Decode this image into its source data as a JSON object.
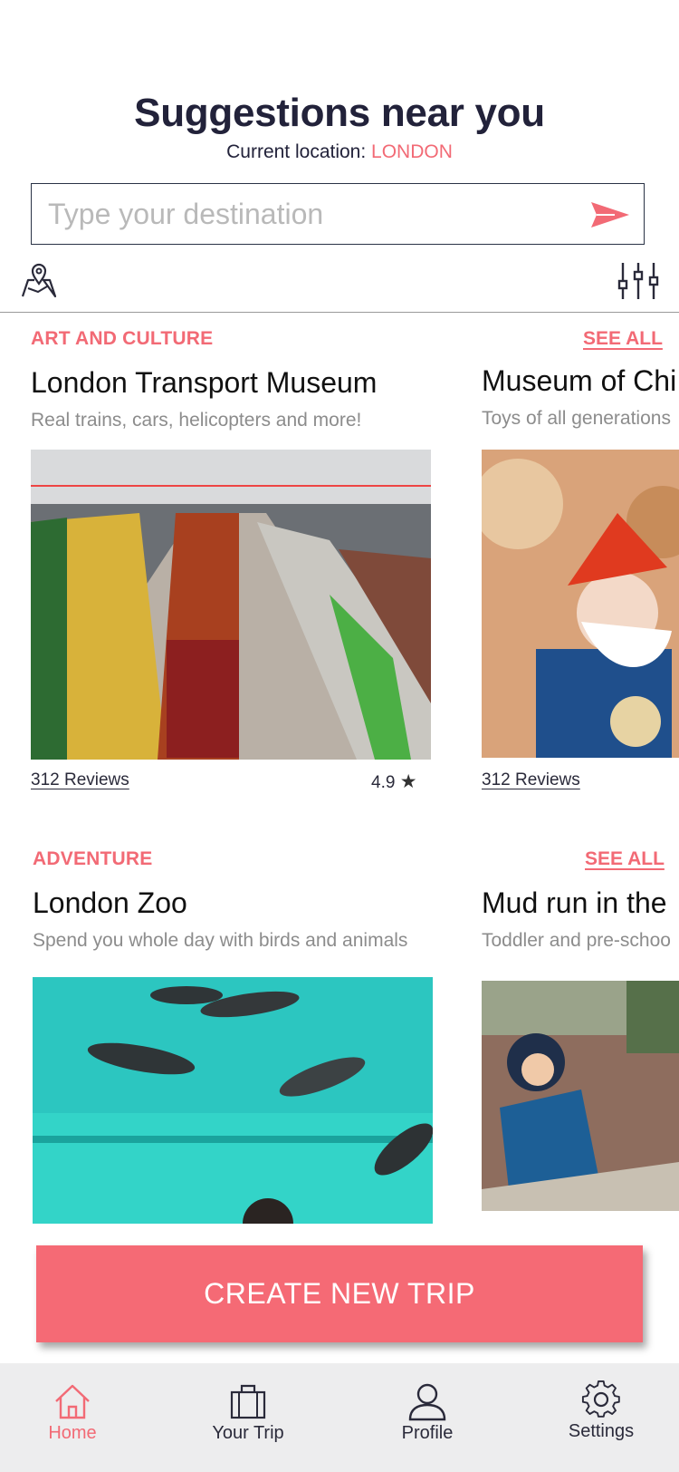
{
  "header": {
    "title": "Suggestions near you",
    "location_label": "Current location: ",
    "location_value": "LONDON"
  },
  "search": {
    "placeholder": "Type your destination",
    "send_icon": "send-arrow-icon"
  },
  "toolbar": {
    "map_icon": "map-pin-icon",
    "filter_icon": "sliders-icon"
  },
  "sections": [
    {
      "category": "ART AND CULTURE",
      "see_all": "SEE ALL",
      "cards": [
        {
          "title": "London Transport Museum",
          "description": "Real trains, cars, helicopters and more!",
          "reviews": "312 Reviews",
          "rating": "4.9"
        },
        {
          "title": "Museum of Chi",
          "description": "Toys of all generations",
          "reviews": "312 Reviews"
        }
      ]
    },
    {
      "category": "ADVENTURE",
      "see_all": "SEE ALL",
      "cards": [
        {
          "title": "London Zoo",
          "description": "Spend you whole day with  birds and animals"
        },
        {
          "title": "Mud run in the",
          "description": "Toddler and pre-schoo"
        }
      ]
    }
  ],
  "cta": {
    "label": "CREATE NEW TRIP"
  },
  "tabbar": {
    "items": [
      {
        "label": "Home",
        "icon": "home-icon",
        "active": true
      },
      {
        "label": "Your Trip",
        "icon": "suitcase-icon"
      },
      {
        "label": "Profile",
        "icon": "profile-icon"
      },
      {
        "label": "Settings",
        "icon": "gear-icon"
      }
    ]
  },
  "colors": {
    "accent": "#f26a75",
    "dark": "#22223a",
    "tabbar_bg": "#ededee"
  }
}
